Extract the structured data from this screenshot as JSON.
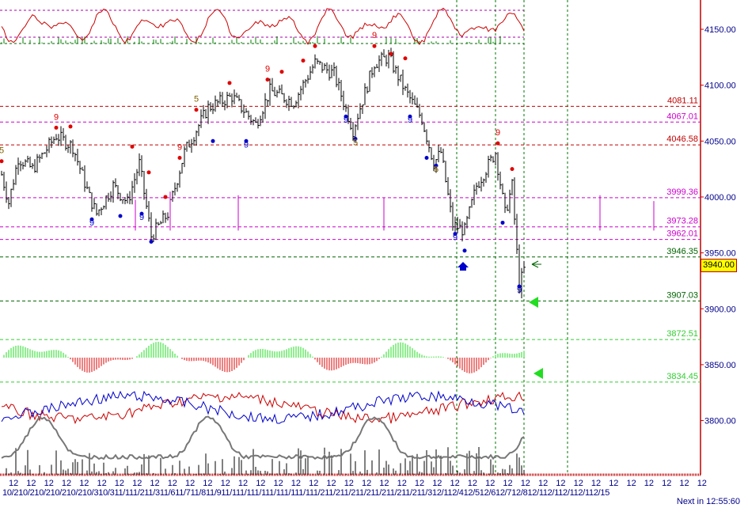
{
  "chart_data": {
    "type": "candlestick",
    "title": "",
    "y_axis": {
      "ticks": [
        4150,
        4100,
        4050,
        4000,
        3950,
        3900,
        3850,
        3800
      ],
      "tick_labels": [
        "4150.00",
        "4100.00",
        "4050.00",
        "4000.00",
        "3950.00",
        "3900.00",
        "3850.00",
        "3800.00"
      ]
    },
    "current_price": "3940.00",
    "levels": [
      {
        "value": "4081.11",
        "color": "#c00000"
      },
      {
        "value": "4067.01",
        "color": "#cc00cc"
      },
      {
        "value": "4046.58",
        "color": "#c00000"
      },
      {
        "value": "3999.36",
        "color": "#cc00cc"
      },
      {
        "value": "3973.28",
        "color": "#cc00cc"
      },
      {
        "value": "3962.01",
        "color": "#cc00cc"
      },
      {
        "value": "3946.35",
        "color": "#006400"
      },
      {
        "value": "3907.03",
        "color": "#006400"
      },
      {
        "value": "3872.51",
        "color": "#33cc33"
      },
      {
        "value": "3834.45",
        "color": "#33cc33"
      }
    ],
    "price_path": [
      [
        0,
        4020
      ],
      [
        3,
        3995
      ],
      [
        7,
        4035
      ],
      [
        13,
        4025
      ],
      [
        23,
        4055
      ],
      [
        30,
        4045
      ],
      [
        37,
        4000
      ],
      [
        40,
        3985
      ],
      [
        47,
        4010
      ],
      [
        53,
        3995
      ],
      [
        58,
        4030
      ],
      [
        63,
        3965
      ],
      [
        70,
        3985
      ],
      [
        77,
        4040
      ],
      [
        87,
        4080
      ],
      [
        97,
        4090
      ],
      [
        107,
        4065
      ],
      [
        113,
        4095
      ],
      [
        123,
        4085
      ],
      [
        132,
        4120
      ],
      [
        140,
        4110
      ],
      [
        148,
        4060
      ],
      [
        157,
        4120
      ],
      [
        163,
        4125
      ],
      [
        170,
        4095
      ],
      [
        177,
        4070
      ],
      [
        182,
        4030
      ],
      [
        185,
        4040
      ],
      [
        190,
        3975
      ],
      [
        195,
        3970
      ],
      [
        200,
        4010
      ],
      [
        208,
        4040
      ],
      [
        212,
        3985
      ],
      [
        215,
        4010
      ],
      [
        218,
        3920
      ],
      [
        220,
        3935
      ]
    ],
    "markers": [
      {
        "bar": 23,
        "price": 4062,
        "color": "#e00000",
        "label": "9"
      },
      {
        "bar": 29,
        "price": 4063,
        "color": "#e00000",
        "label": ""
      },
      {
        "bar": 0,
        "price": 4032,
        "color": "#e00000",
        "label": "5"
      },
      {
        "bar": 38,
        "price": 3980,
        "color": "#0000cc",
        "label": "9"
      },
      {
        "bar": 50,
        "price": 3983,
        "color": "#0000cc",
        "label": ""
      },
      {
        "bar": 55,
        "price": 4045,
        "color": "#e00000",
        "label": ""
      },
      {
        "bar": 59,
        "price": 3985,
        "color": "#0000cc",
        "label": "9"
      },
      {
        "bar": 63,
        "price": 3960,
        "color": "#0000cc",
        "label": ""
      },
      {
        "bar": 62,
        "price": 4022,
        "color": "#e00000",
        "label": ""
      },
      {
        "bar": 69,
        "price": 4000,
        "color": "#e00000",
        "label": ""
      },
      {
        "bar": 75,
        "price": 4035,
        "color": "#e00000",
        "label": "9"
      },
      {
        "bar": 82,
        "price": 4078,
        "color": "#e00000",
        "label": "5"
      },
      {
        "bar": 89,
        "price": 4050,
        "color": "#0000cc",
        "label": ""
      },
      {
        "bar": 96,
        "price": 4102,
        "color": "#e00000",
        "label": ""
      },
      {
        "bar": 103,
        "price": 4050,
        "color": "#0000cc",
        "label": "9"
      },
      {
        "bar": 112,
        "price": 4105,
        "color": "#e00000",
        "label": "9"
      },
      {
        "bar": 118,
        "price": 4112,
        "color": "#e00000",
        "label": ""
      },
      {
        "bar": 127,
        "price": 4122,
        "color": "#e00000",
        "label": ""
      },
      {
        "bar": 132,
        "price": 4135,
        "color": "#e00000",
        "label": ""
      },
      {
        "bar": 145,
        "price": 4072,
        "color": "#0000cc",
        "label": "9"
      },
      {
        "bar": 149,
        "price": 4052,
        "color": "#0000cc",
        "label": "5"
      },
      {
        "bar": 157,
        "price": 4135,
        "color": "#e00000",
        "label": "9"
      },
      {
        "bar": 164,
        "price": 4128,
        "color": "#e00000",
        "label": ""
      },
      {
        "bar": 170,
        "price": 4124,
        "color": "#e00000",
        "label": ""
      },
      {
        "bar": 172,
        "price": 4072,
        "color": "#0000cc",
        "label": "9"
      },
      {
        "bar": 179,
        "price": 4035,
        "color": "#0000cc",
        "label": ""
      },
      {
        "bar": 183,
        "price": 4028,
        "color": "#0000cc",
        "label": "5"
      },
      {
        "bar": 191,
        "price": 3967,
        "color": "#0000cc",
        "label": "9"
      },
      {
        "bar": 195,
        "price": 3952,
        "color": "#0000cc",
        "label": ""
      },
      {
        "bar": 209,
        "price": 4048,
        "color": "#e00000",
        "label": "9"
      },
      {
        "bar": 211,
        "price": 3977,
        "color": "#0000cc",
        "label": ""
      },
      {
        "bar": 215,
        "price": 4025,
        "color": "#e00000",
        "label": ""
      },
      {
        "bar": 218,
        "price": 3920,
        "color": "#0000cc",
        "label": "9"
      }
    ],
    "x_axis": {
      "hour_label": "12",
      "date_row": "10/210/210/210/210/210/310/311/111/211/311/611/711/811/911/111/111/111/111/111/111/211/211/211/211/211/211/211/312/112/412/512/612/712/812/112/112/112/112/15"
    },
    "grid": "dashed vertical/horizontal levels"
  },
  "status": {
    "next_bar": "Next in 12:55:60"
  },
  "colors": {
    "axis": "#c00000",
    "tick_text": "#00008b",
    "bars": "#000000",
    "hist_up": "#22dd22",
    "hist_down": "#dd0000"
  }
}
